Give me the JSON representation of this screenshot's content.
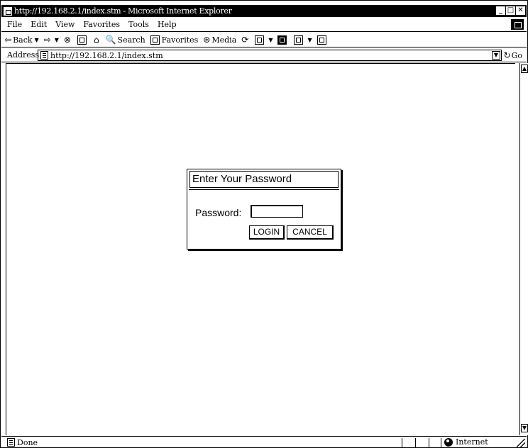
{
  "window": {
    "title": "http://192.168.2.1/index.stm - Microsoft Internet Explorer",
    "minimize_label": "_",
    "maximize_label": "□",
    "close_label": "✕"
  },
  "menu": {
    "items": [
      {
        "label": "File"
      },
      {
        "label": "Edit"
      },
      {
        "label": "View"
      },
      {
        "label": "Favorites"
      },
      {
        "label": "Tools"
      },
      {
        "label": "Help"
      }
    ]
  },
  "toolbar": {
    "back_label": "Back",
    "back_icon": "⇦",
    "forward_icon": "⇨",
    "stop_icon": "⊗",
    "search_label": "Search",
    "search_icon": "🔍",
    "favorites_label": "Favorites",
    "media_label": "Media",
    "media_icon": "⊛",
    "home_icon": "⌂",
    "history_icon": "⟳",
    "dropdown_icon": "▼"
  },
  "address": {
    "label": "Address",
    "url": "http://192.168.2.1/index.stm",
    "go_label": "Go",
    "go_icon": "↻"
  },
  "dialog": {
    "title": "Enter Your Password",
    "password_label": "Password:",
    "password_value": "",
    "login_label": "LOGIN",
    "cancel_label": "CANCEL"
  },
  "scrollbar": {
    "up_icon": "▲",
    "down_icon": "▼"
  },
  "status": {
    "text": "Done",
    "zone": "Internet"
  }
}
